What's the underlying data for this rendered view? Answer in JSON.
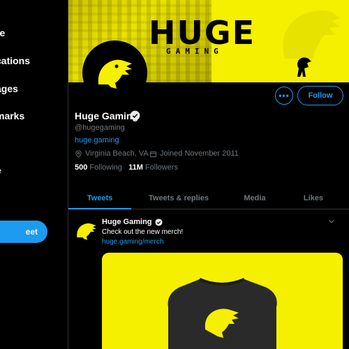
{
  "sidebar": {
    "items": [
      {
        "label": "re"
      },
      {
        "label": "cations"
      },
      {
        "label": "ages"
      },
      {
        "label": "marks"
      },
      {
        "label": "e"
      }
    ],
    "tweet_button_label": "eet"
  },
  "profile": {
    "banner": {
      "brand_text": "HUGE",
      "sub_text": "GAMING"
    },
    "name": "Huge Gaming",
    "handle": "@hugegaming",
    "website": "huge.gaming",
    "location": "Virginia Beach, VA",
    "joined": "Joined November 2011",
    "following_count": "500",
    "following_label": "Following",
    "followers_count": "11M",
    "followers_label": "Followers",
    "more_label": "•••",
    "follow_label": "Follow"
  },
  "tabs": [
    {
      "label": "Tweets",
      "active": true
    },
    {
      "label": "Tweets & replies",
      "active": false
    },
    {
      "label": "Media",
      "active": false
    },
    {
      "label": "Likes",
      "active": false
    }
  ],
  "tweet": {
    "author": "Huge Gaming",
    "text": "Check out the new merch!",
    "link": "huge.gaming/merch"
  },
  "colors": {
    "accent": "#1d9bf0",
    "brand_yellow": "#f5ef00",
    "background": "#000000",
    "muted": "#6e767d"
  }
}
